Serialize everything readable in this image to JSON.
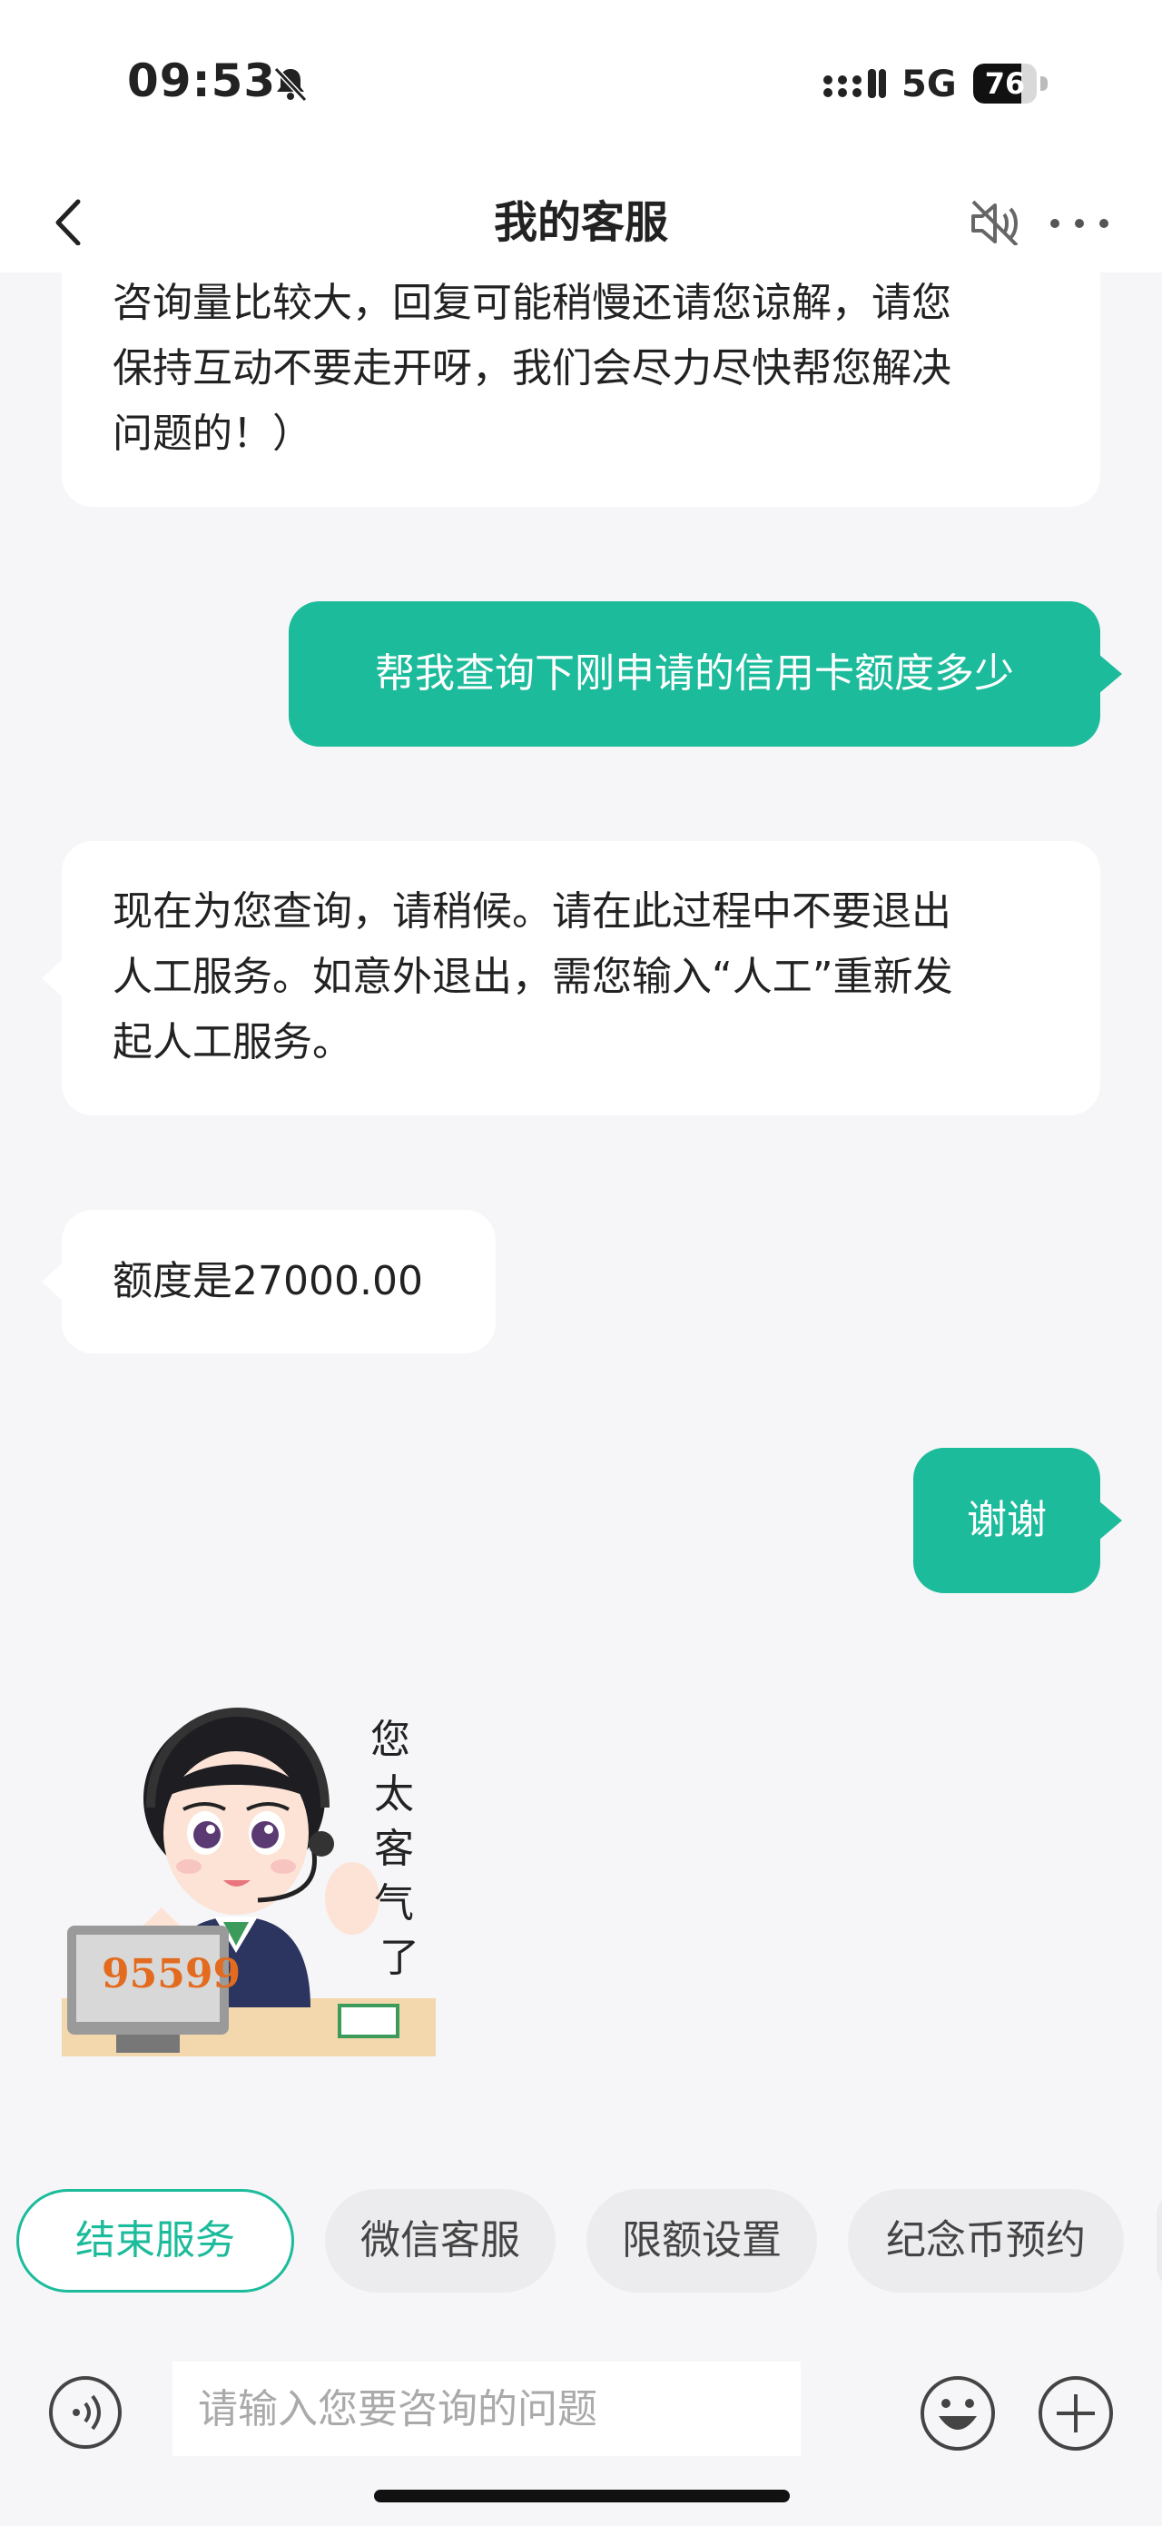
{
  "status_bar": {
    "time": "09:53",
    "network": "5G",
    "battery_level": "76"
  },
  "header": {
    "title": "我的客服"
  },
  "messages": [
    {
      "from": "agent",
      "lines": [
        "咨询量比较大，回复可能稍慢还请您谅解，请您",
        "保持互动不要走开呀，我们会尽力尽快帮您解决",
        "问题的！）"
      ]
    },
    {
      "from": "user",
      "text": "帮我查询下刚申请的信用卡额度多少"
    },
    {
      "from": "agent",
      "lines": [
        "现在为您查询，请稍候。请在此过程中不要退出",
        "人工服务。如意外退出，需您输入“人工”重新发",
        "起人工服务。"
      ]
    },
    {
      "from": "agent",
      "text": "额度是27000.00"
    },
    {
      "from": "user",
      "text": "谢谢"
    }
  ],
  "sticker": {
    "caption": "您太客气了",
    "logo_text": "95599"
  },
  "quick_actions": [
    "结束服务",
    "微信客服",
    "限额设置",
    "纪念币预约"
  ],
  "input": {
    "placeholder": "请输入您要咨询的问题"
  },
  "colors": {
    "accent": "#1cbb9b",
    "agent_bubble": "#ffffff",
    "background": "#f6f6f8"
  }
}
